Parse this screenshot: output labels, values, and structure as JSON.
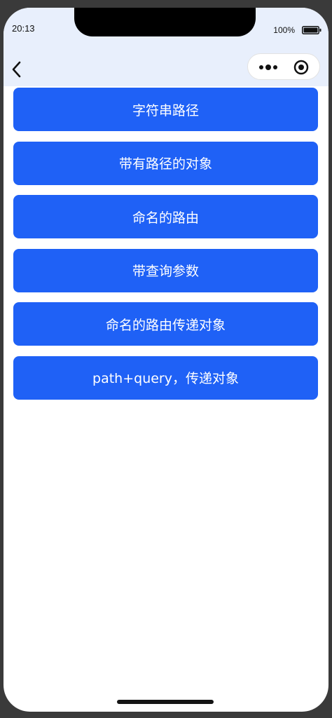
{
  "status_bar": {
    "time": "20:13",
    "battery": "100%"
  },
  "nav_bar": {
    "back_icon": "chevron-left-icon",
    "capsule": {
      "more_icon": "more-dots-icon",
      "close_icon": "target-circle-icon"
    }
  },
  "buttons": [
    {
      "label": "字符串路径"
    },
    {
      "label": "带有路径的对象"
    },
    {
      "label": "命名的路由"
    },
    {
      "label": "带查询参数"
    },
    {
      "label": "命名的路由传递对象"
    },
    {
      "label": "path+query，传递对象"
    }
  ],
  "colors": {
    "button": "#1f61f6",
    "button_text": "#ffffff",
    "header_bg": "#e8effc"
  }
}
